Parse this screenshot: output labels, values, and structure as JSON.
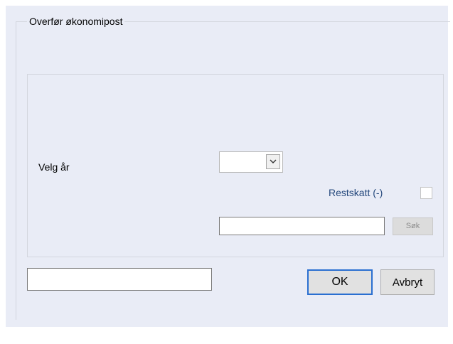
{
  "dialog": {
    "group_title": "Overfør økonomipost",
    "year": {
      "label": "Velg år",
      "selected_value": ""
    },
    "restskatt": {
      "label": "Restskatt (-)",
      "checked": false
    },
    "search": {
      "value": "",
      "button_label": "Søk",
      "button_enabled": false
    },
    "status_field": {
      "value": ""
    },
    "buttons": {
      "ok_label": "OK",
      "cancel_label": "Avbryt"
    }
  },
  "icons": {
    "dropdown": "chevron-down-icon"
  },
  "colors": {
    "client_background": "#e9ecf6",
    "restskatt_label": "#24487c",
    "default_button_border": "#2a6fd1"
  }
}
